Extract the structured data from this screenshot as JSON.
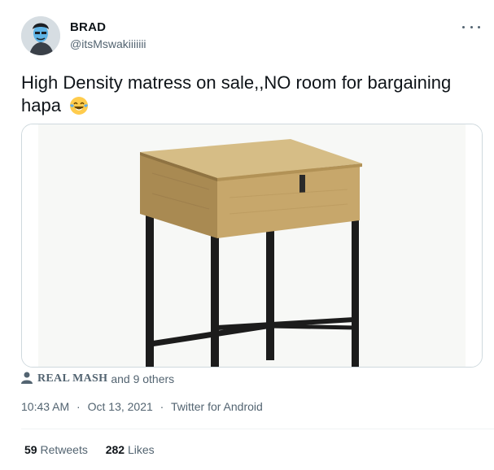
{
  "author": {
    "name": "BRAD",
    "handle": "@itsMswakiiiiiii"
  },
  "tweet": {
    "text": "High Density matress on sale,,NO room for bargaining hapa",
    "emoji": "face-with-tears-of-joy-icon"
  },
  "social_context": {
    "name": "REAL MASH",
    "rest": "and 9 others",
    "icon": "person-icon"
  },
  "meta": {
    "time": "10:43 AM",
    "date": "Oct 13, 2021",
    "source": "Twitter for Android",
    "separator": "·"
  },
  "stats": {
    "retweets_count": "59",
    "retweets_label": "Retweets",
    "likes_count": "282",
    "likes_label": "Likes"
  },
  "colors": {
    "text": "#0f1419",
    "secondary": "#536471",
    "border": "#cfd9de"
  }
}
